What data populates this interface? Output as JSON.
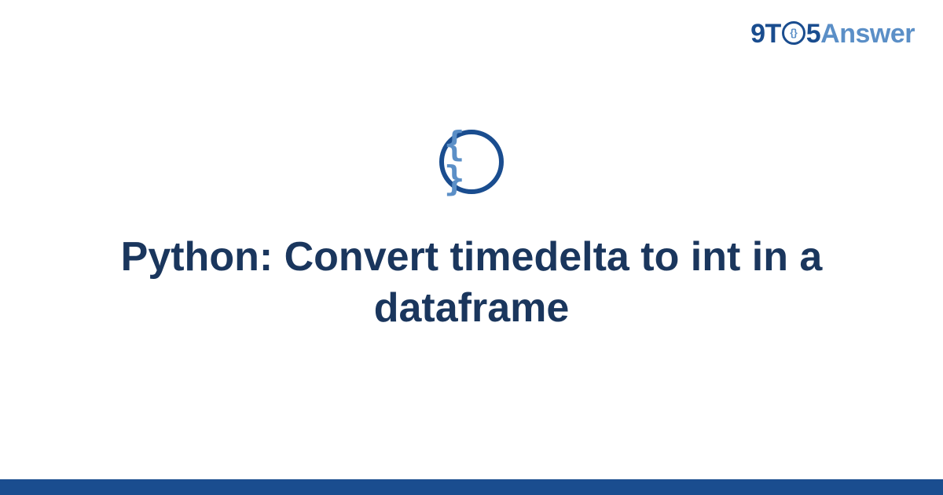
{
  "logo": {
    "part1": "9T",
    "circle_inner": "{}",
    "part2": "5",
    "part3": "Answer"
  },
  "icon": {
    "glyph": "{ }"
  },
  "title": "Python: Convert timedelta to int in a dataframe"
}
